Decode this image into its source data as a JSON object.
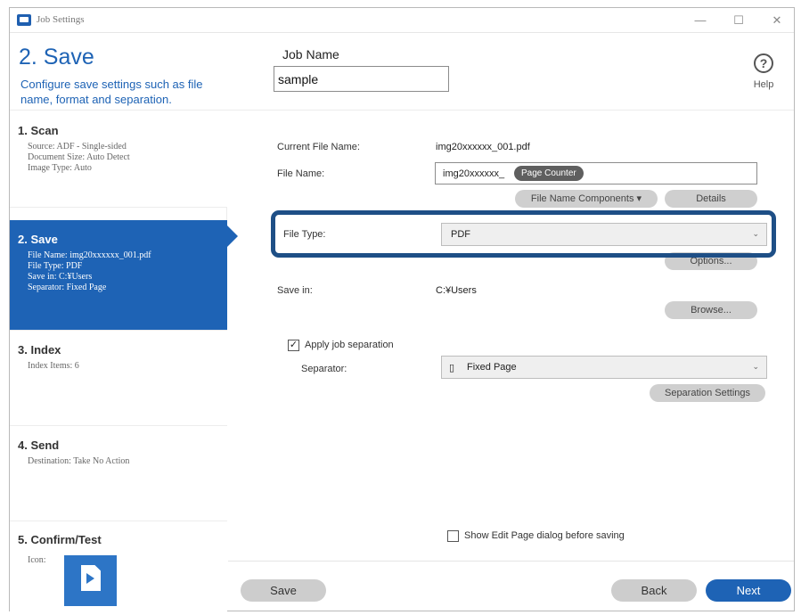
{
  "window": {
    "title": "Job Settings",
    "minimize": "—",
    "maximize": "☐",
    "close": "✕"
  },
  "header": {
    "step_title": "2. Save",
    "step_desc": "Configure save settings such as file name, format and separation.",
    "job_name_label": "Job Name",
    "job_name_value": "sample",
    "help_icon": "?",
    "help_label": "Help"
  },
  "sidebar": {
    "items": [
      {
        "title": "1. Scan",
        "detail": "Source: ADF - Single-sided\nDocument Size: Auto Detect\nImage Type: Auto"
      },
      {
        "title": "2. Save",
        "detail": "File Name: img20xxxxxx_001.pdf\nFile Type: PDF\nSave in: C:¥Users\nSeparator: Fixed Page"
      },
      {
        "title": "3. Index",
        "detail": "Index Items: 6"
      },
      {
        "title": "4. Send",
        "detail": "Destination: Take No Action"
      },
      {
        "title": "5. Confirm/Test",
        "detail": "Icon:"
      }
    ]
  },
  "content": {
    "current_file_name_label": "Current File Name:",
    "current_file_name_value": "img20xxxxxx_001.pdf",
    "file_name_label": "File Name:",
    "file_name_prefix": "img20xxxxxx_",
    "page_counter_token": "Page Counter",
    "file_name_components_button": "File Name Components ▾",
    "details_button": "Details",
    "file_type_label": "File Type:",
    "file_type_value": "PDF",
    "options_button": "Options...",
    "save_in_label": "Save in:",
    "save_in_value": "C:¥Users",
    "browse_button": "Browse...",
    "apply_separation_label": "Apply job separation",
    "apply_separation_checked": true,
    "separator_label": "Separator:",
    "separator_value": "Fixed Page",
    "separation_settings_button": "Separation Settings",
    "show_edit_page_label": "Show Edit Page dialog before saving",
    "show_edit_page_checked": false,
    "check_mark": "✓"
  },
  "footer": {
    "save_button": "Save",
    "back_button": "Back",
    "next_button": "Next"
  },
  "colors": {
    "accent": "#1e63b5",
    "highlight_border": "#1e4f86"
  }
}
